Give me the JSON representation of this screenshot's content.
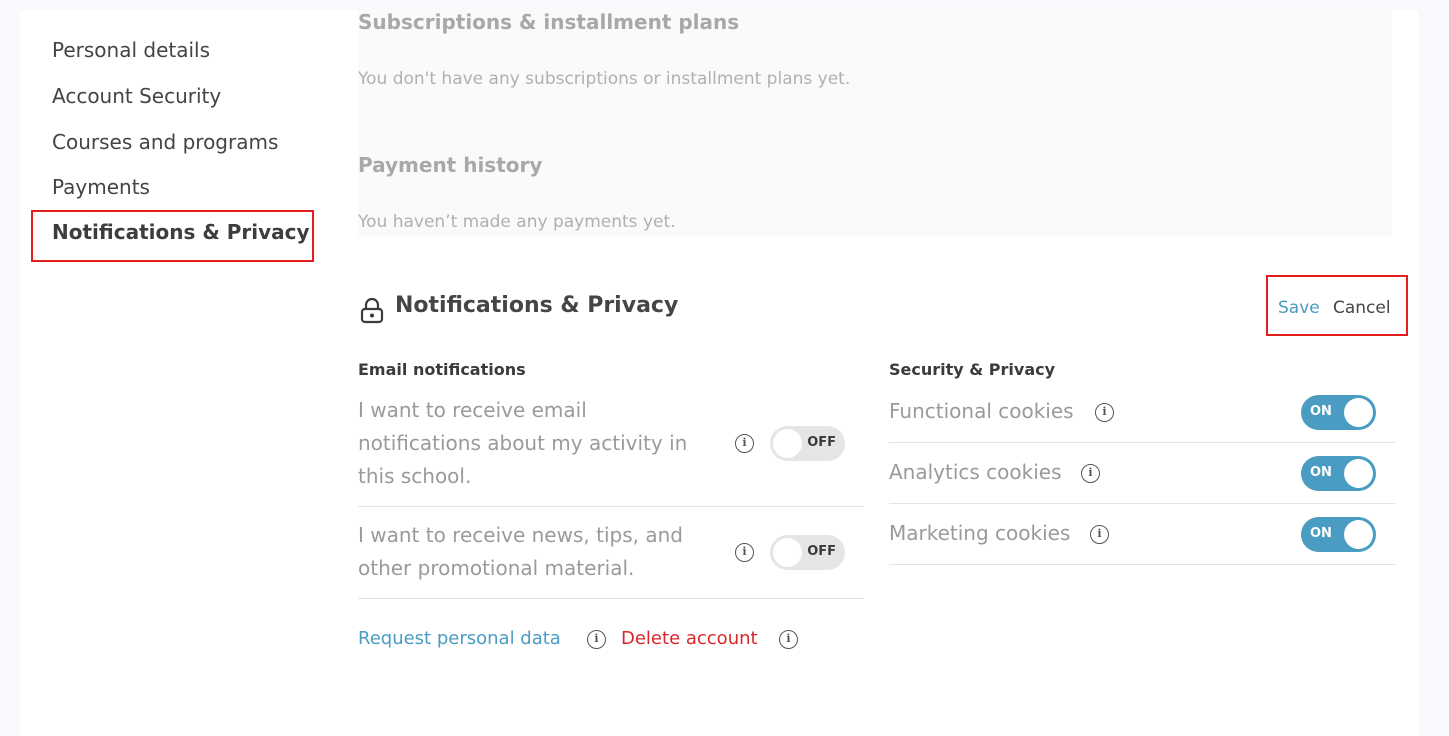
{
  "sidebar": {
    "items": [
      {
        "label": "Personal details"
      },
      {
        "label": "Account Security"
      },
      {
        "label": "Courses and programs"
      },
      {
        "label": "Payments"
      },
      {
        "label": "Notifications & Privacy"
      }
    ]
  },
  "payments": {
    "subscriptions_title": "Subscriptions & installment plans",
    "subscriptions_empty": "You don't have any subscriptions or installment plans yet.",
    "history_title": "Payment history",
    "history_empty": "You haven’t made any payments yet."
  },
  "section": {
    "title": "Notifications & Privacy",
    "save_label": "Save",
    "cancel_label": "Cancel"
  },
  "email_notifications": {
    "heading": "Email notifications",
    "items": [
      {
        "line1": "I want to receive email",
        "line2": "notifications about my activity in",
        "line3": "this school.",
        "state": "OFF"
      },
      {
        "line1": "I want to receive news, tips, and",
        "line2": "other promotional material.",
        "state": "OFF"
      }
    ]
  },
  "security_privacy": {
    "heading": "Security & Privacy",
    "items": [
      {
        "label": "Functional cookies",
        "state": "ON"
      },
      {
        "label": "Analytics cookies",
        "state": "ON"
      },
      {
        "label": "Marketing cookies",
        "state": "ON"
      }
    ]
  },
  "actions": {
    "request_data": "Request personal data",
    "delete_account": "Delete account"
  },
  "icons": {
    "info": "info-icon",
    "lock": "lock-icon"
  },
  "colors": {
    "accent": "#4a9cc2",
    "danger": "#d9262b",
    "highlight": "#e21d1d"
  }
}
